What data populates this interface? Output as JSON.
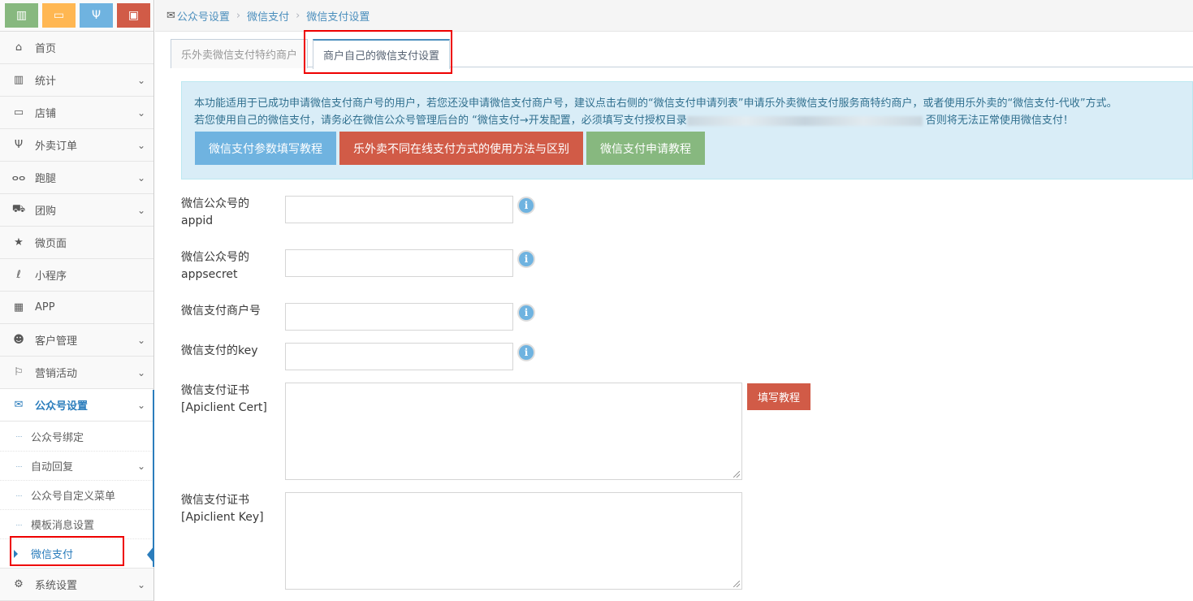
{
  "shortcuts": [
    {
      "icon": "bar-chart-icon",
      "color": "#87b87f",
      "glyph": "▥"
    },
    {
      "icon": "monitor-icon",
      "color": "#ffb752",
      "glyph": "▭"
    },
    {
      "icon": "utensils-icon",
      "color": "#6fb3e0",
      "glyph": "Ψ"
    },
    {
      "icon": "shopping-bag-icon",
      "color": "#d15b47",
      "glyph": "▣"
    }
  ],
  "sidebar": {
    "items": [
      {
        "label": "首页",
        "icon": "home-icon",
        "glyph": "⌂",
        "chevron": false
      },
      {
        "label": "统计",
        "icon": "bar-chart-icon",
        "glyph": "▥",
        "chevron": true
      },
      {
        "label": "店铺",
        "icon": "desktop-icon",
        "glyph": "▭",
        "chevron": true
      },
      {
        "label": "外卖订单",
        "icon": "cutlery-icon",
        "glyph": "Ψ",
        "chevron": true
      },
      {
        "label": "跑腿",
        "icon": "bicycle-icon",
        "glyph": "ⴰⴰ",
        "chevron": true
      },
      {
        "label": "团购",
        "icon": "cart-icon",
        "glyph": "⛟",
        "chevron": true
      },
      {
        "label": "微页面",
        "icon": "star-icon",
        "glyph": "★",
        "chevron": false
      },
      {
        "label": "小程序",
        "icon": "mini-program-icon",
        "glyph": "ℓ",
        "chevron": false
      },
      {
        "label": "APP",
        "icon": "grid-icon",
        "glyph": "▦",
        "chevron": false
      },
      {
        "label": "客户管理",
        "icon": "users-icon",
        "glyph": "☻",
        "chevron": true
      },
      {
        "label": "营销活动",
        "icon": "flag-icon",
        "glyph": "⚐",
        "chevron": true
      },
      {
        "label": "公众号设置",
        "icon": "wechat-icon",
        "glyph": "✉",
        "chevron": true
      }
    ],
    "sub_items": [
      {
        "label": "公众号绑定",
        "chevron": false
      },
      {
        "label": "自动回复",
        "chevron": true
      },
      {
        "label": "公众号自定义菜单",
        "chevron": false
      },
      {
        "label": "模板消息设置",
        "chevron": false
      },
      {
        "label": "微信支付",
        "chevron": false
      }
    ],
    "last_item": {
      "label": "系统设置",
      "icon": "gear-icon",
      "glyph": "⚙"
    }
  },
  "breadcrumb": [
    "公众号设置",
    "微信支付",
    "微信支付设置"
  ],
  "tabs": [
    "乐外卖微信支付特约商户",
    "商户自己的微信支付设置"
  ],
  "alert": {
    "line1": "本功能适用于已成功申请微信支付商户号的用户，若您还没申请微信支付商户号，建议点击右侧的“微信支付申请列表”申请乐外卖微信支付服务商特约商户，或者使用乐外卖的“微信支付-代收”方式。",
    "line2_a": "若您使用自己的微信支付，请务必在微信公众号管理后台的 “微信支付→开发配置，必须填写支付授权目录",
    "line2_b": "否则将无法正常使用微信支付！",
    "buttons": [
      {
        "label": "微信支付参数填写教程",
        "color": "#6fb3e0"
      },
      {
        "label": "乐外卖不同在线支付方式的使用方法与区别",
        "color": "#d15b47"
      },
      {
        "label": "微信支付申请教程",
        "color": "#87b87f"
      }
    ]
  },
  "form": {
    "appid_label_1": "微信公众号的",
    "appid_label_2": "appid",
    "appsecret_label_1": "微信公众号的",
    "appsecret_label_2": "appsecret",
    "mchid_label": "微信支付商户号",
    "key_label": "微信支付的key",
    "cert_label_1": "微信支付证书",
    "cert_label_2": "[Apiclient Cert]",
    "certkey_label_1": "微信支付证书",
    "certkey_label_2": "[Apiclient Key]",
    "appid_value": "",
    "appsecret_value": "",
    "mchid_value": "",
    "key_value": "",
    "cert_value": "",
    "certkey_value": "",
    "info_glyph": "i",
    "tutorial_button": "填写教程"
  }
}
